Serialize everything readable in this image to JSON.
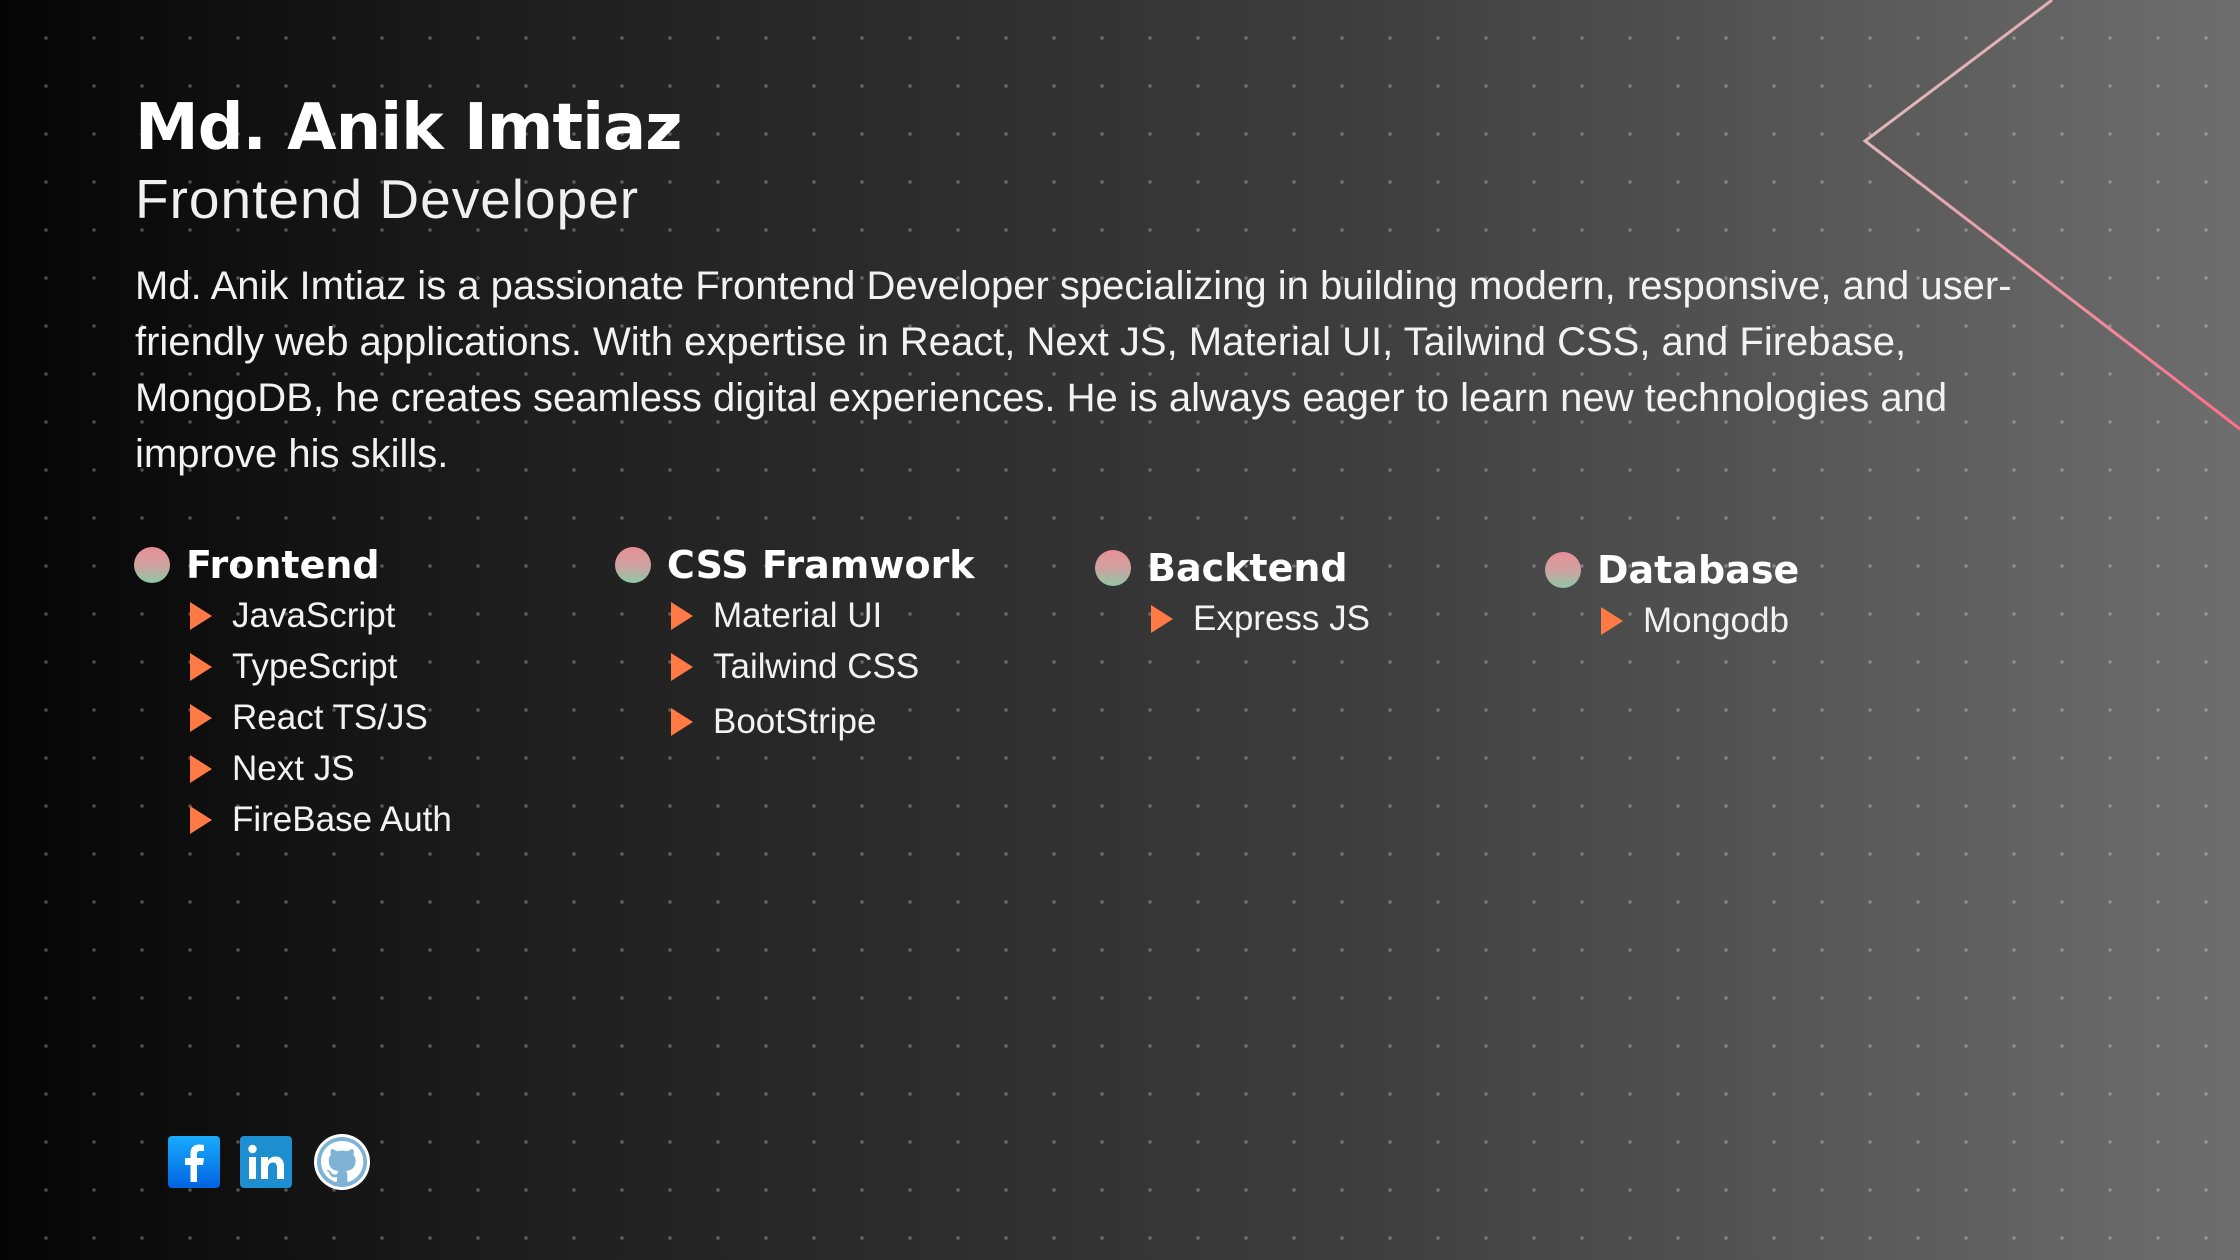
{
  "profile": {
    "name": "Md. Anik Imtiaz",
    "role": "Frontend Developer",
    "bio": "Md. Anik Imtiaz is a passionate Frontend Developer specializing in building modern, responsive, and user-friendly web applications. With expertise in React, Next JS, Material UI, Tailwind CSS, and Firebase, MongoDB, he creates seamless digital experiences. He is always eager to learn new technologies and improve his skills."
  },
  "skills": [
    {
      "title": "Frontend",
      "items": [
        "JavaScript",
        "TypeScript",
        "React TS/JS",
        "Next JS",
        "FireBase Auth"
      ]
    },
    {
      "title": "CSS Framwork",
      "items": [
        "Material UI",
        "Tailwind CSS",
        "BootStripe"
      ]
    },
    {
      "title": "Backtend",
      "items": [
        "Express JS"
      ]
    },
    {
      "title": "Database",
      "items": [
        "Mongodb"
      ]
    }
  ],
  "socials": [
    {
      "icon": "facebook-icon",
      "letter": "f",
      "color": "#1877f2"
    },
    {
      "icon": "linkedin-icon",
      "letter": "in",
      "color": "#0a66c2"
    },
    {
      "icon": "github-icon",
      "color": "#7fb3d5"
    }
  ],
  "colors": {
    "accent_triangle": "#ff7a45",
    "line_start": "#d8c3c3",
    "line_end": "#ff6e8a"
  }
}
